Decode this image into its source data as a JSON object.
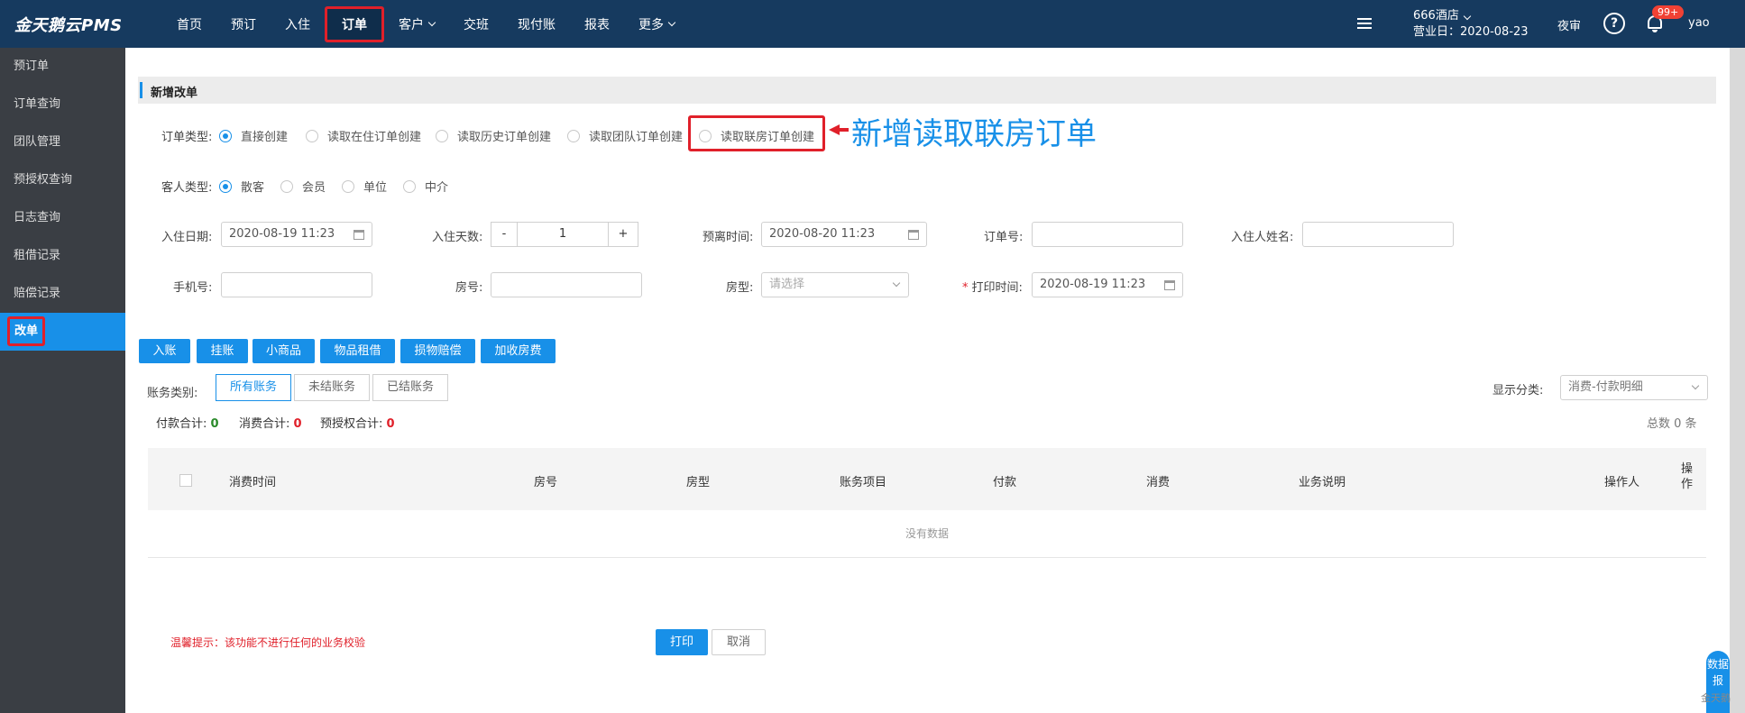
{
  "brand": "金天鹅云PMS",
  "nav": [
    {
      "label": "首页",
      "caret": false
    },
    {
      "label": "预订",
      "caret": false
    },
    {
      "label": "入住",
      "caret": false
    },
    {
      "label": "订单",
      "caret": false,
      "active": true
    },
    {
      "label": "客户",
      "caret": true
    },
    {
      "label": "交班",
      "caret": false
    },
    {
      "label": "现付账",
      "caret": false
    },
    {
      "label": "报表",
      "caret": false
    },
    {
      "label": "更多",
      "caret": true
    }
  ],
  "header": {
    "hotel_name": "666酒店",
    "business_day": "营业日：2020-08-23",
    "night_audit": "夜审",
    "notif_badge": "99+",
    "user": "yao"
  },
  "sidebar": [
    "预订单",
    "订单查询",
    "团队管理",
    "预授权查询",
    "日志查询",
    "租借记录",
    "赔偿记录",
    "改单"
  ],
  "section_title": "新增改单",
  "order_type": {
    "label": "订单类型:",
    "options": [
      "直接创建",
      "读取在住订单创建",
      "读取历史订单创建",
      "读取团队订单创建",
      "读取联房订单创建"
    ],
    "selected": 0
  },
  "callout": "新增读取联房订单",
  "guest_type": {
    "label": "客人类型:",
    "options": [
      "散客",
      "会员",
      "单位",
      "中介"
    ],
    "selected": 0
  },
  "fields": {
    "checkin_label": "入住日期:",
    "checkin_value": "2020-08-19 11:23",
    "days_label": "入住天数:",
    "days_minus": "-",
    "days_value": "1",
    "days_plus": "+",
    "depart_label": "预离时间:",
    "depart_value": "2020-08-20 11:23",
    "order_no_label": "订单号:",
    "guest_name_label": "入住人姓名:",
    "phone_label": "手机号:",
    "room_no_label": "房号:",
    "room_type_label": "房型:",
    "room_type_placeholder": "请选择",
    "print_time_required": "*",
    "print_time_label": "打印时间:",
    "print_time_value": "2020-08-19 11:23"
  },
  "actions": [
    "入账",
    "挂账",
    "小商品",
    "物品租借",
    "损物赔偿",
    "加收房费"
  ],
  "account": {
    "label": "账务类别:",
    "tabs": [
      "所有账务",
      "未结账务",
      "已结账务"
    ],
    "display_label": "显示分类:",
    "display_value": "消费-付款明细"
  },
  "summary": {
    "pay_label": "付款合计:",
    "pay_value": "0",
    "consume_label": "消费合计:",
    "consume_value": "0",
    "preauth_label": "预授权合计:",
    "preauth_value": "0",
    "total": "总数 0 条"
  },
  "table": {
    "headers": [
      "消费时间",
      "房号",
      "房型",
      "账务项目",
      "付款",
      "消费",
      "业务说明",
      "操作人",
      "操作"
    ],
    "empty": "没有数据"
  },
  "footer": {
    "tip": "温馨提示：该功能不进行任何的业务校验",
    "print": "打印",
    "cancel": "取消"
  },
  "float_button": "数据报",
  "watermark": "金天鹅"
}
